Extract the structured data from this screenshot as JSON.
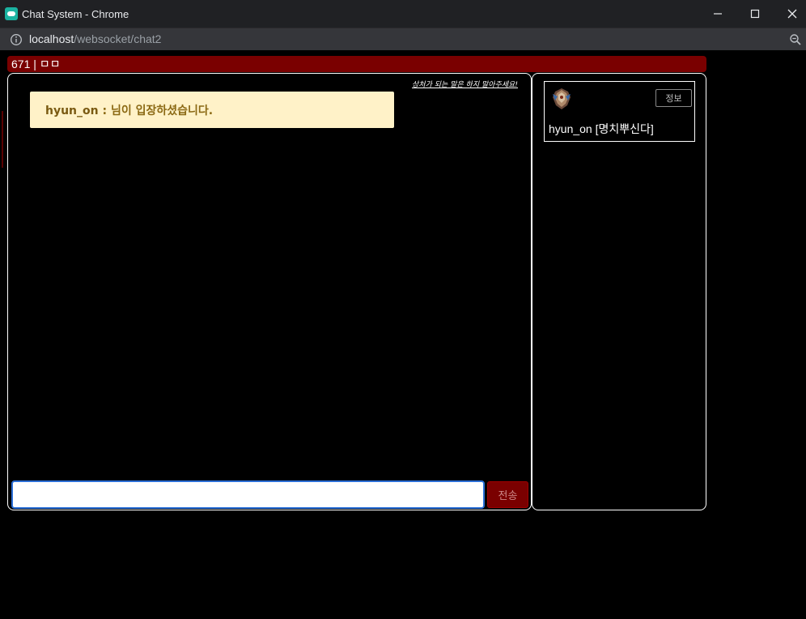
{
  "window": {
    "title": "Chat System - Chrome"
  },
  "address": {
    "host": "localhost",
    "path": "/websocket/chat2"
  },
  "room": {
    "title": "671 | ㅁㅁ"
  },
  "chat": {
    "notice": "상처가 되는 말은 하지 말아주세요!",
    "messages": [
      {
        "user": "hyun_on",
        "separator": " : ",
        "text": "님이 입장하셨습니다."
      }
    ],
    "input": {
      "value": "",
      "placeholder": ""
    },
    "send_label": "전송"
  },
  "users": [
    {
      "name": "hyun_on [명치뿌신다]",
      "info_label": "정보",
      "avatar_icon": "rank-emblem-icon"
    }
  ],
  "colors": {
    "accent": "#7a0000",
    "message_bg": "#fff2c8",
    "message_text": "#8b6914",
    "input_focus": "#2b6fd6"
  }
}
